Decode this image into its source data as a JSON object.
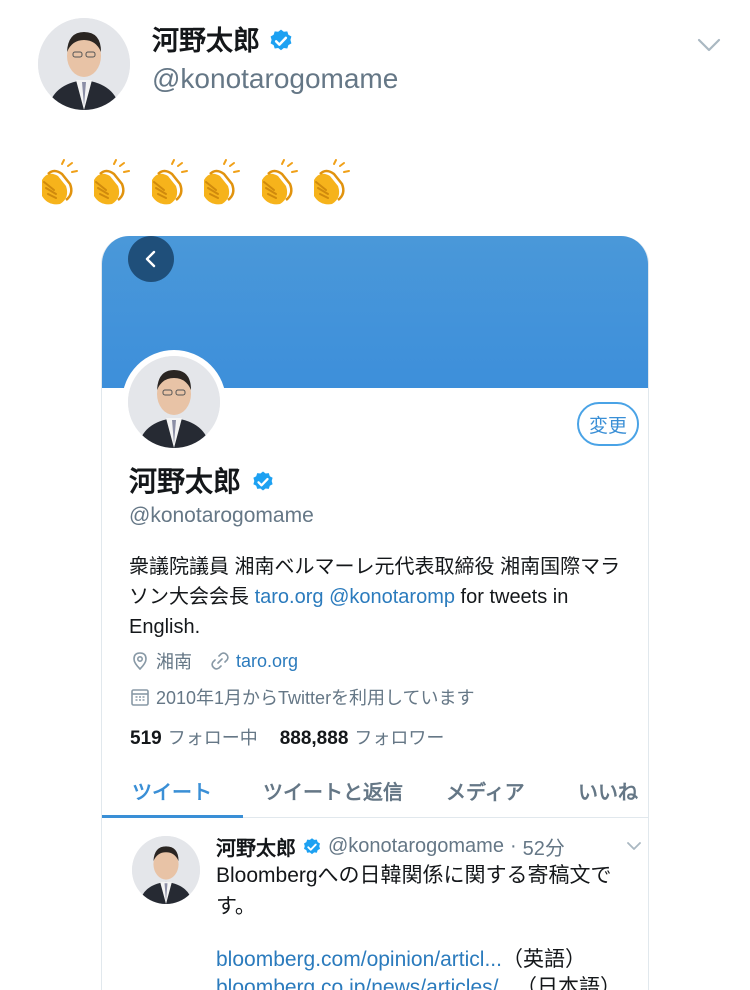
{
  "colors": {
    "accent": "#3a8fd6",
    "banner": "#4a98d9",
    "verified": "#1da1f2",
    "muted": "#657786"
  },
  "header": {
    "name": "河野太郎",
    "handle": "@konotarogomame"
  },
  "tweet": {
    "emoji_count": 6,
    "emoji_icon": "clapping-hands-icon"
  },
  "card": {
    "edit_label": "変更",
    "name": "河野太郎",
    "handle": "@konotarogomame",
    "bio_line1": "衆議院議員 湘南ベルマーレ元代表取締役 湘南国際マラ",
    "bio_line2_prefix": "ソン大会会長 ",
    "bio_link1": "taro.org",
    "bio_link2": "@konotaromp",
    "bio_suffix": " for tweets in",
    "bio_line3": "English.",
    "location": "湘南",
    "website": "taro.org",
    "joined": "2010年1月からTwitterを利用しています",
    "following_count": "519",
    "following_label": "フォロー中",
    "followers_count": "888,888",
    "followers_label": "フォロワー",
    "tabs": [
      "ツイート",
      "ツイートと返信",
      "メディア",
      "いいね"
    ],
    "active_tab": 0,
    "tweet": {
      "name": "河野太郎",
      "handle": "@konotarogomame",
      "sep": "·",
      "time": "52分",
      "text_line1": "Bloombergへの日韓関係に関する寄稿文で",
      "text_line2": "す。",
      "link1": "bloomberg.com/opinion/articl...",
      "link1_note": "（英語）",
      "link2": "bloomberg.co.jp/news/articles/...",
      "link2_note": "（日本語）"
    }
  }
}
